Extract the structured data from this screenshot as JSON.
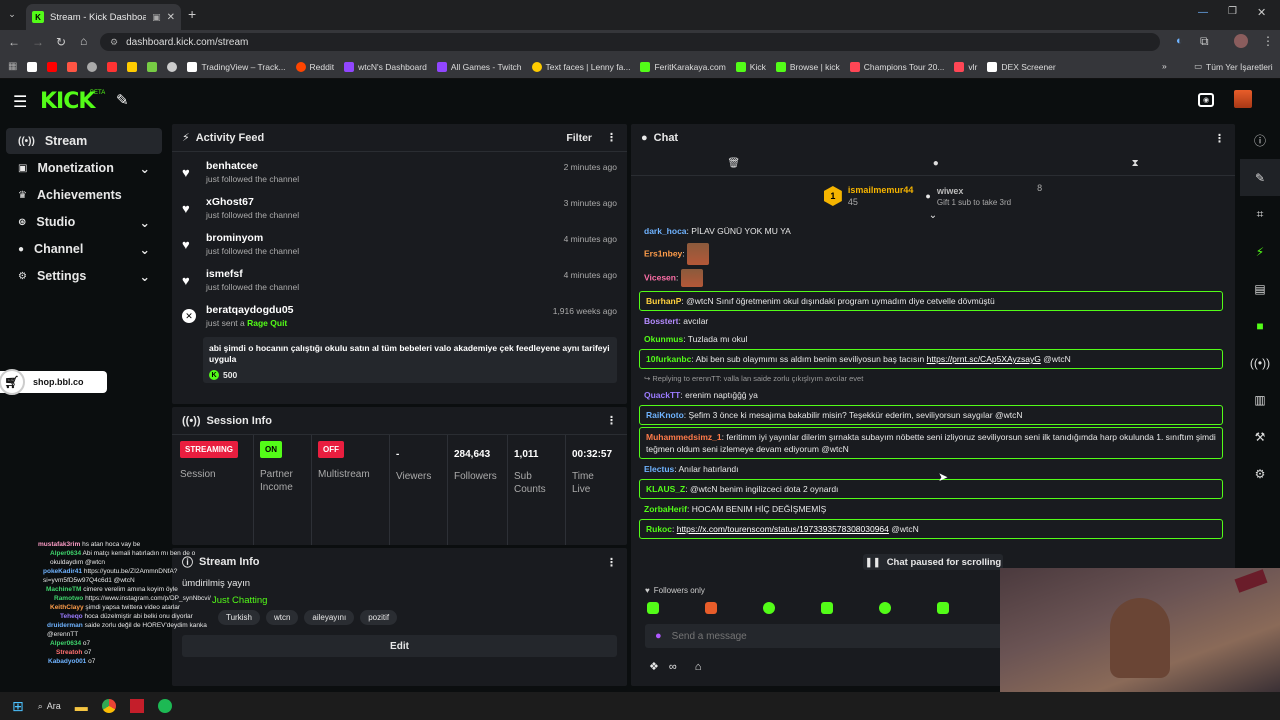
{
  "browser": {
    "tab_title": "Stream - Kick Dashboard",
    "url": "dashboard.kick.com/stream",
    "bookmarks": [
      "TradingView – Track...",
      "Reddit",
      "wtcN's Dashboard",
      "All Games - Twitch",
      "Text faces | Lenny fa...",
      "FeritKarakaya.com",
      "Kick",
      "Browse | kick",
      "Champions Tour 20...",
      "vlr",
      "DEX Screener"
    ],
    "all_bookmarks": "Tüm Yer İşaretleri"
  },
  "app": {
    "logo": "KICK",
    "beta": "BETA"
  },
  "sidebar": {
    "items": [
      {
        "label": "Stream",
        "icon": "broadcast-icon"
      },
      {
        "label": "Monetization",
        "icon": "dollar-icon"
      },
      {
        "label": "Achievements",
        "icon": "trophy-icon"
      },
      {
        "label": "Studio",
        "icon": "video-icon"
      },
      {
        "label": "Channel",
        "icon": "user-icon"
      },
      {
        "label": "Settings",
        "icon": "gear-icon"
      }
    ],
    "shop_tag": "shop.bbl.co"
  },
  "activity": {
    "title": "Activity Feed",
    "filter": "Filter",
    "items": [
      {
        "name": "benhatcee",
        "action": "just followed the channel",
        "time": "2 minutes ago"
      },
      {
        "name": "xGhost67",
        "action": "just followed the channel",
        "time": "3 minutes ago"
      },
      {
        "name": "brominyom",
        "action": "just followed the channel",
        "time": "4 minutes ago"
      },
      {
        "name": "ismefsf",
        "action": "just followed the channel",
        "time": "4 minutes ago"
      }
    ],
    "raid": {
      "name": "beratqaydogdu05",
      "action_prefix": "just sent a",
      "action": "Rage Quit",
      "time": "1,916 weeks ago",
      "message": "abi şimdi o hocanın çalıştığı okulu satın al tüm bebeleri valo akademiye çek feedleyene aynı tarifeyi uygula",
      "amount": "500"
    }
  },
  "session": {
    "title": "Session Info",
    "cells": [
      {
        "badge": "STREAMING",
        "label": "Session"
      },
      {
        "badge": "ON",
        "label": "Partner Income"
      },
      {
        "badge": "OFF",
        "label": "Multistream"
      },
      {
        "value": "-",
        "label": "Viewers"
      },
      {
        "value": "284,643",
        "label": "Followers"
      },
      {
        "value": "1,011",
        "label": "Sub Counts"
      },
      {
        "value": "00:32:57",
        "label": "Time Live"
      }
    ]
  },
  "stream_info": {
    "title": "Stream Info",
    "stream_title": "ümdirilmiş yayın",
    "category": "Just Chatting",
    "tags": [
      "Turkish",
      "wtcn",
      "aileyayını",
      "pozitif"
    ],
    "edit": "Edit"
  },
  "chat": {
    "title": "Chat",
    "leader": {
      "rank": "1",
      "user": "ismailmemur44",
      "count": "45",
      "user2": "wiwex",
      "count2": "8",
      "gift": "Gift 1 sub to take 3rd"
    },
    "messages": [
      {
        "user": "dark_hoca",
        "color": "#6fb3ff",
        "text": "PİLAV GÜNÜ YOK MU YA"
      },
      {
        "user": "Ers1nbey",
        "color": "#ff9d4a",
        "text": "",
        "emote": true
      },
      {
        "user": "Vicesen",
        "color": "#ff6fa8",
        "text": "",
        "emote": true
      },
      {
        "user": "BurhanP",
        "color": "#ffd23f",
        "text": "@wtcN Sınıf öğretmenim okul dışındaki program uymadım diye cetvelle dövmüştü",
        "hl": true
      },
      {
        "user": "Bosstert",
        "color": "#b58cff",
        "text": "avcılar"
      },
      {
        "user": "Okunmus",
        "color": "#53fc18",
        "text": "Tuzlada mı okul"
      },
      {
        "user": "10furkanbc",
        "color": "#53fc18",
        "text": "Abi ben sub olaymımı ss aldım benim seviliyosun baş tacısın",
        "link": "https://prnt.sc/CAp5XAyzsayG",
        "tail": "@wtcN",
        "hl": true
      },
      {
        "user": "QuackTT",
        "color": "#9b7bff",
        "text": "erenim naptığğğ ya",
        "reply": "Replying to erennTT: valla lan saide zorlu çıkışlıyım avcılar evet"
      },
      {
        "user": "RaiKnoto",
        "color": "#6fb3ff",
        "text": "Şefim 3 önce ki mesajıma bakabilir misin? Teşekkür ederim, seviliyorsun saygılar @wtcN",
        "hl": true
      },
      {
        "user": "Muhammedsimz_1",
        "color": "#ff7b4a",
        "text": "feritimm iyi yayınlar dilerim şırnakta subayım nöbette seni izliyoruz seviliyorsun seni ilk tanıdığımda harp okulunda 1. sınıftım şimdi teğmen oldum seni izlemeye devam ediyorum @wtcN",
        "hl": true
      },
      {
        "user": "Electus",
        "color": "#6fb3ff",
        "text": "Anılar hatırlandı"
      },
      {
        "user": "KLAUS_Z",
        "color": "#53fc18",
        "text": "@wtcN benim ingilizceci dota 2 oynardı",
        "hl": true
      },
      {
        "user": "ZorbaHerif",
        "color": "#53fc18",
        "text": "HOCAM BENIM HİÇ DEĞİŞMEMİŞ"
      },
      {
        "user": "Rukoc",
        "color": "#53fc18",
        "text": "",
        "link": "https://x.com/tourenscom/status/1973393578308030964",
        "tail": "@wtcN",
        "hl": true
      }
    ],
    "paused": "Chat paused for scrolling",
    "followers_only": "Followers only",
    "placeholder": "Send a message"
  },
  "overlay_chat": [
    {
      "user": "mustafak3rim",
      "text": "hs atan hoca vay be"
    },
    {
      "user": "Alper0634",
      "text": "Abi matçı kemali hatırladın mı ben de o okuldaydım @wtcn"
    },
    {
      "user": "pokeKadir41",
      "text": "https://youtu.be/ZI2AmmnDNfA?si=yvm5fD5w97Q4c6d1 @wtcN"
    },
    {
      "user": "MachineTM",
      "text": "cimere verelim amına koyim öyle"
    },
    {
      "user": "Ramotwo",
      "text": "https://www.instagram.com/p/DP_synNbcvi/"
    },
    {
      "user": "KeithClayy",
      "text": "şimdi yapsa twittera video atarlar"
    },
    {
      "user": "Teheqo",
      "text": "hoca düzelmiştir abi belki onu diyorlar"
    },
    {
      "user": "druiderman",
      "text": "saide zorlu değil de HOREV'deydim kanka @erennTT"
    },
    {
      "user": "Alper0634",
      "text": "o7"
    },
    {
      "user": "Streatoh",
      "text": "o7"
    },
    {
      "user": "Kabadyo001",
      "text": "o7"
    }
  ],
  "taskbar": {
    "search": "Ara"
  }
}
